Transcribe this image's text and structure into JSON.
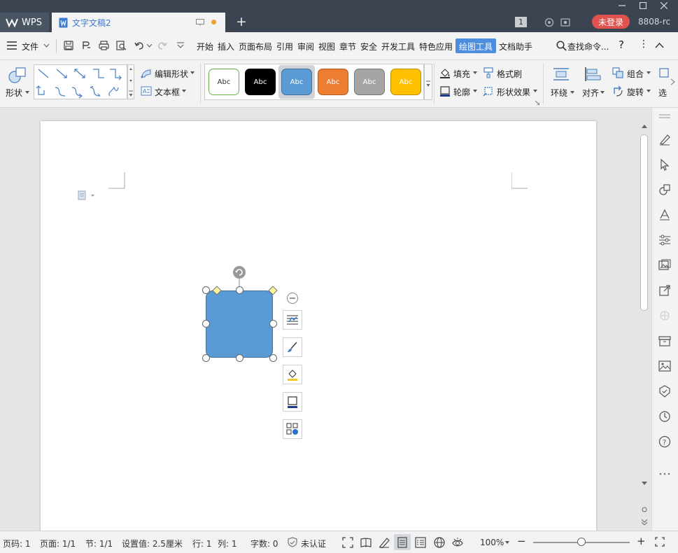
{
  "titlebar": {
    "app_name": "WPS",
    "doc_tab_title": "文字文稿2",
    "new_tab": "+",
    "badge_count": "1",
    "login_label": "未登录",
    "user_id": "8808-rc"
  },
  "menubar": {
    "file": "文件",
    "tabs": [
      "开始",
      "插入",
      "页面布局",
      "引用",
      "审阅",
      "视图",
      "章节",
      "安全",
      "开发工具",
      "特色应用",
      "绘图工具",
      "文档助手"
    ],
    "active_tab": "绘图工具",
    "search": "查找命令..."
  },
  "ribbon": {
    "shape_label": "形状",
    "edit_shape": "编辑形状",
    "text_box": "文本框",
    "style_samples": [
      {
        "label": "Abc",
        "fill": "#ffffff",
        "border": "#6bb04a",
        "text": "#333333"
      },
      {
        "label": "Abc",
        "fill": "#000000",
        "border": "#000000",
        "text": "#ffffff"
      },
      {
        "label": "Abc",
        "fill": "#5b9bd5",
        "border": "#41719c",
        "text": "#ffffff"
      },
      {
        "label": "Abc",
        "fill": "#ed7d31",
        "border": "#ae5a21",
        "text": "#ffffff"
      },
      {
        "label": "Abc",
        "fill": "#a5a5a5",
        "border": "#787878",
        "text": "#ffffff"
      },
      {
        "label": "Abc",
        "fill": "#ffc000",
        "border": "#bc8c00",
        "text": "#ffffff"
      }
    ],
    "selected_style_index": 2,
    "fill": "填充",
    "outline": "轮廓",
    "format_painter": "格式刷",
    "shape_effects": "形状效果",
    "wrap": "环绕",
    "align": "对齐",
    "group": "组合",
    "rotate": "旋转",
    "select_partial": "选"
  },
  "shape": {
    "fill_color": "#5b9bd5",
    "border_color": "#41719c"
  },
  "statusbar": {
    "page": "页码: 1",
    "pages": "页面: 1/1",
    "section": "节: 1/1",
    "setting": "设置值: 2.5厘米",
    "row": "行: 1",
    "col": "列: 1",
    "word_count": "字数: 0",
    "cert": "未认证",
    "zoom": "100%",
    "zoom_minus": "−",
    "zoom_plus": "+"
  },
  "colors": {
    "accent": "#4d8ee0",
    "titlebar": "#3c4452",
    "login": "#e0524d"
  }
}
